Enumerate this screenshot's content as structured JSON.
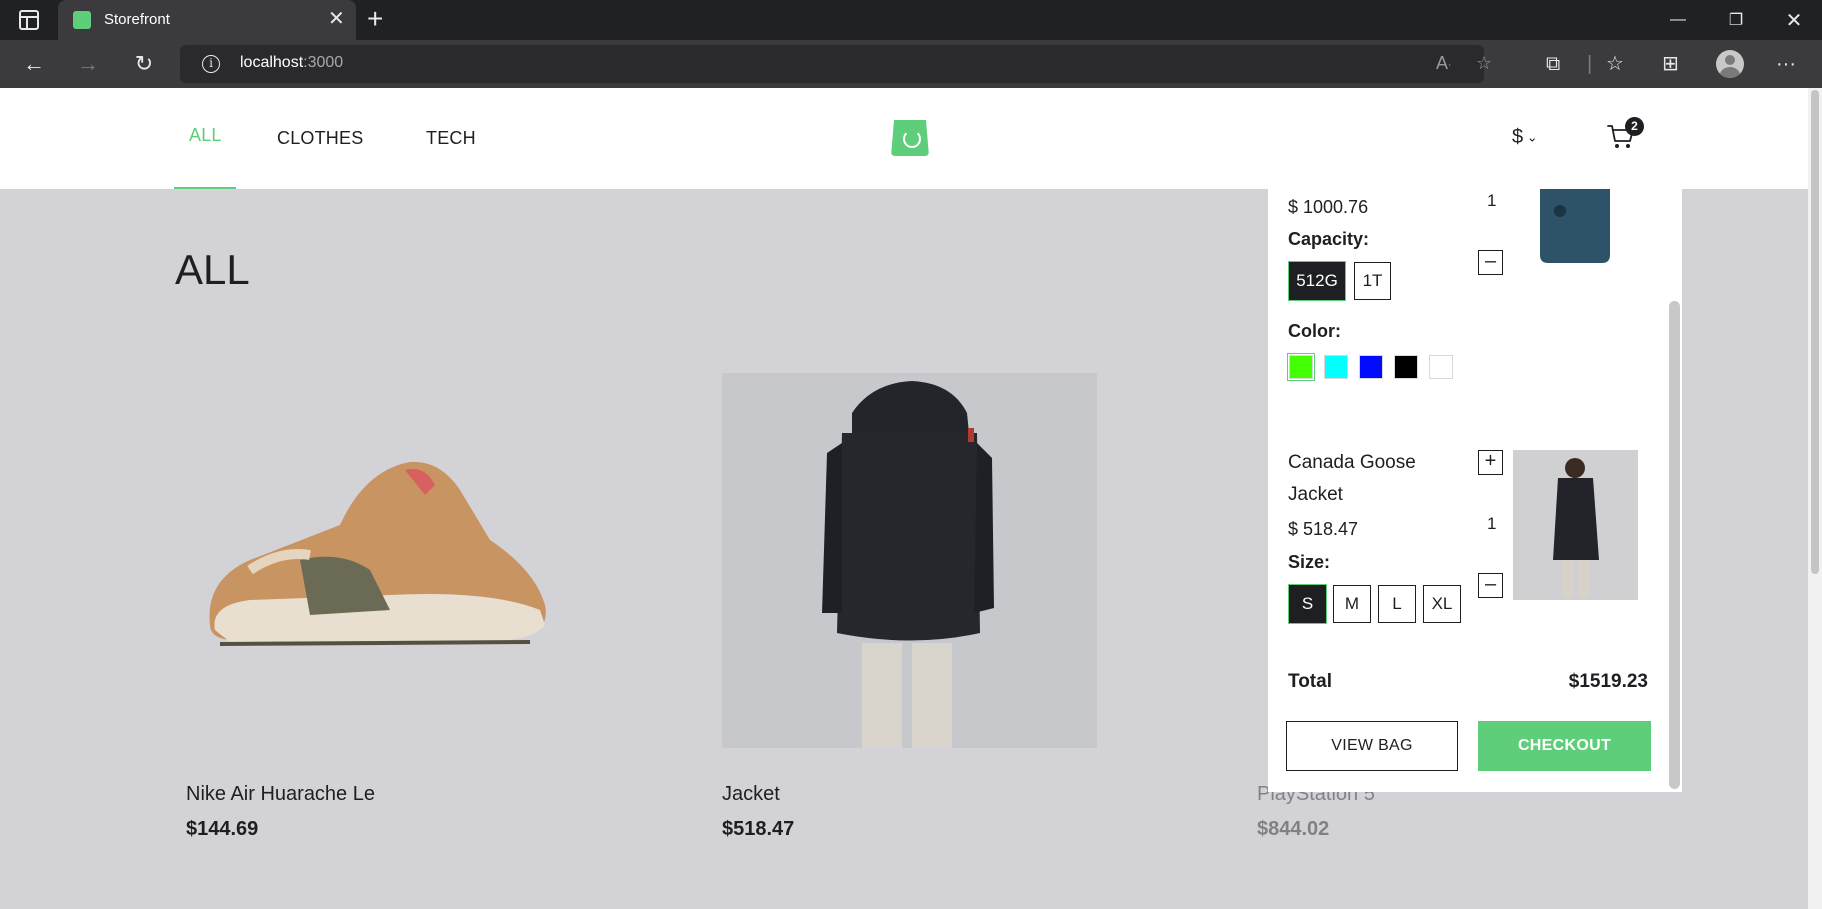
{
  "browser": {
    "tab_title": "Storefront",
    "url_host": "localhost",
    "url_port": ":3000",
    "icons": [
      "tab-actions-icon",
      "close-icon",
      "new-tab-icon",
      "minimize-icon",
      "maximize-icon",
      "close-window-icon",
      "back-icon",
      "forward-icon",
      "reload-icon",
      "info-icon",
      "read-aloud-icon",
      "favorite-add-icon",
      "extensions-icon",
      "favorites-icon",
      "collections-icon",
      "profile-icon",
      "more-icon"
    ]
  },
  "header": {
    "nav": [
      {
        "label": "ALL",
        "active": true
      },
      {
        "label": "CLOTHES",
        "active": false
      },
      {
        "label": "TECH",
        "active": false
      }
    ],
    "currency": "$",
    "cart_count": "2",
    "accent_color": "#5ece7b"
  },
  "page": {
    "title": "ALL",
    "products": [
      {
        "name": "Nike Air Huarache Le",
        "price": "$144.69"
      },
      {
        "name": "Jacket",
        "price": "$518.47"
      },
      {
        "name": "PlayStation 5",
        "price": "$844.02"
      }
    ]
  },
  "minicart": {
    "items": [
      {
        "price": "$ 1000.76",
        "attr_label": "Capacity:",
        "capacity_options": [
          "512G",
          "1T"
        ],
        "selected_capacity": "512G",
        "color_label": "Color:",
        "colors": [
          "#44ff03",
          "#03ffff",
          "#030bff",
          "#000000",
          "#ffffff"
        ],
        "selected_color": "#44ff03",
        "qty": "1"
      },
      {
        "name_line1": "Canada Goose",
        "name_line2": "Jacket",
        "price": "$ 518.47",
        "attr_label": "Size:",
        "size_options": [
          "S",
          "M",
          "L",
          "XL"
        ],
        "selected_size": "S",
        "qty": "1",
        "plus": "+",
        "minus": "–"
      }
    ],
    "total_label": "Total",
    "total_value": "$1519.23",
    "view_bag": "VIEW BAG",
    "checkout": "CHECKOUT"
  }
}
